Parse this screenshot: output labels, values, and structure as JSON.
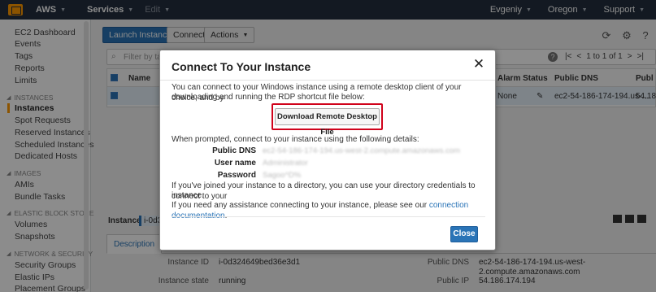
{
  "topbar": {
    "brand": "AWS",
    "services": "Services",
    "edit": "Edit",
    "user": "Evgeniy",
    "region": "Oregon",
    "support": "Support"
  },
  "sidebar": {
    "ec2_dashboard": "EC2 Dashboard",
    "events": "Events",
    "tags": "Tags",
    "reports": "Reports",
    "limits": "Limits",
    "section_instances": "INSTANCES",
    "instances": "Instances",
    "spot_requests": "Spot Requests",
    "reserved_instances": "Reserved Instances",
    "scheduled_instances": "Scheduled Instances",
    "dedicated_hosts": "Dedicated Hosts",
    "section_images": "IMAGES",
    "amis": "AMIs",
    "bundle_tasks": "Bundle Tasks",
    "section_ebs": "ELASTIC BLOCK STORE",
    "volumes": "Volumes",
    "snapshots": "Snapshots",
    "section_network": "NETWORK & SECURITY",
    "security_groups": "Security Groups",
    "elastic_ips": "Elastic IPs",
    "placement_groups": "Placement Groups"
  },
  "toolbar": {
    "launch": "Launch Instance",
    "connect": "Connect",
    "actions": "Actions"
  },
  "filter": {
    "placeholder": "Filter by tags",
    "pager": "1 to 1 of 1"
  },
  "table": {
    "col_name": "Name",
    "col_alarm": "Alarm Status",
    "col_dns": "Public DNS",
    "col_ip": "Publ",
    "row_alarm": "None",
    "row_dns": "ec2-54-186-174-194.us-...",
    "row_ip": "54.18"
  },
  "detail": {
    "instance_label": "Instance:",
    "instance_value": "i-0d3",
    "tab_description": "Description",
    "k_instance_id": "Instance ID",
    "v_instance_id": "i-0d324649bed36e3d1",
    "k_instance_state": "Instance state",
    "v_instance_state": "running",
    "k_public_dns": "Public DNS",
    "v_public_dns_1": "ec2-54-186-174-194.us-west-",
    "v_public_dns_2": "2.compute.amazonaws.com",
    "k_public_ip": "Public IP",
    "v_public_ip": "54.186.174.194"
  },
  "modal": {
    "title": "Connect To Your Instance",
    "intro_1": "You can connect to your Windows instance using a remote desktop client of your choice, and by",
    "intro_2": "downloading and running the RDP shortcut file below:",
    "download_button": "Download Remote Desktop File",
    "prompt": "When prompted, connect to your instance using the following details:",
    "key_dns": "Public DNS",
    "val_dns": "ec2-54-186-174-194.us-west-2.compute.amazonaws.com",
    "key_user": "User name",
    "val_user": "Administrator",
    "key_password": "Password",
    "val_password": "Sagoo^D%",
    "joined_1": "If you've joined your instance to a directory, you can use your directory credentials to connect to your",
    "joined_2": "instance.",
    "help_text": "If you need any assistance connecting to your instance, please see our",
    "help_link": "connection documentation",
    "help_end": ".",
    "close_button": "Close"
  }
}
